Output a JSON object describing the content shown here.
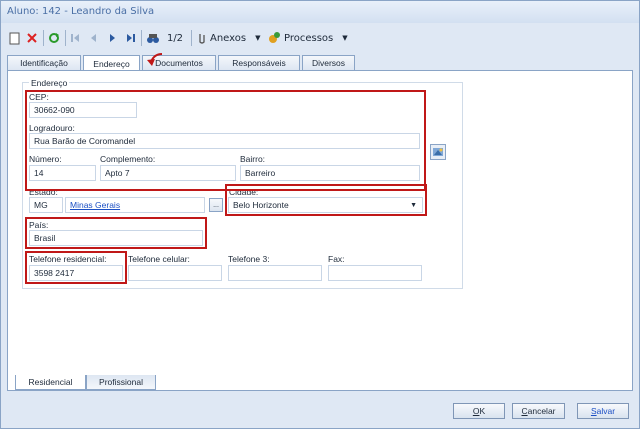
{
  "window": {
    "title": "Aluno: 142 - Leandro da Silva"
  },
  "toolbar": {
    "record_counter": "1/2",
    "anexos_label": "Anexos",
    "processos_label": "Processos"
  },
  "tabs": [
    {
      "label": "Identificação"
    },
    {
      "label": "Endereço"
    },
    {
      "label": "Documentos"
    },
    {
      "label": "Responsáveis"
    },
    {
      "label": "Diversos"
    }
  ],
  "endereco": {
    "group_title": "Endereço",
    "cep": {
      "label": "CEP:",
      "value": "30662-090"
    },
    "logradouro": {
      "label": "Logradouro:",
      "value": "Rua Barão de Coromandel"
    },
    "numero": {
      "label": "Número:",
      "value": "14"
    },
    "complemento": {
      "label": "Complemento:",
      "value": "Apto 7"
    },
    "bairro": {
      "label": "Bairro:",
      "value": "Barreiro"
    },
    "estado": {
      "label": "Estado:",
      "code": "MG",
      "name": "Minas Gerais",
      "browse": "..."
    },
    "cidade": {
      "label": "Cidade:",
      "value": "Belo Horizonte"
    },
    "pais": {
      "label": "País:",
      "value": "Brasil"
    },
    "telefone_residencial": {
      "label": "Telefone residencial:",
      "value": "3598 2417"
    },
    "telefone_celular": {
      "label": "Telefone celular:",
      "value": ""
    },
    "telefone_3": {
      "label": "Telefone 3:",
      "value": ""
    },
    "fax": {
      "label": "Fax:",
      "value": ""
    }
  },
  "bottom_tabs": [
    {
      "label": "Residencial"
    },
    {
      "label": "Profissional"
    }
  ],
  "footer": {
    "ok": "OK",
    "cancelar": "Cancelar",
    "salvar": "Salvar"
  },
  "colors": {
    "highlight_red": "#c01818",
    "link_blue": "#1b4fc4",
    "window_bg": "#dfe8f4"
  },
  "icons": [
    "new-icon",
    "delete-icon",
    "refresh-icon",
    "first-icon",
    "previous-icon",
    "next-icon",
    "last-icon",
    "binoculars-icon",
    "paperclip-icon",
    "processos-icon",
    "map-icon",
    "dropdown-arrow-icon",
    "arrow-annotation-icon"
  ]
}
